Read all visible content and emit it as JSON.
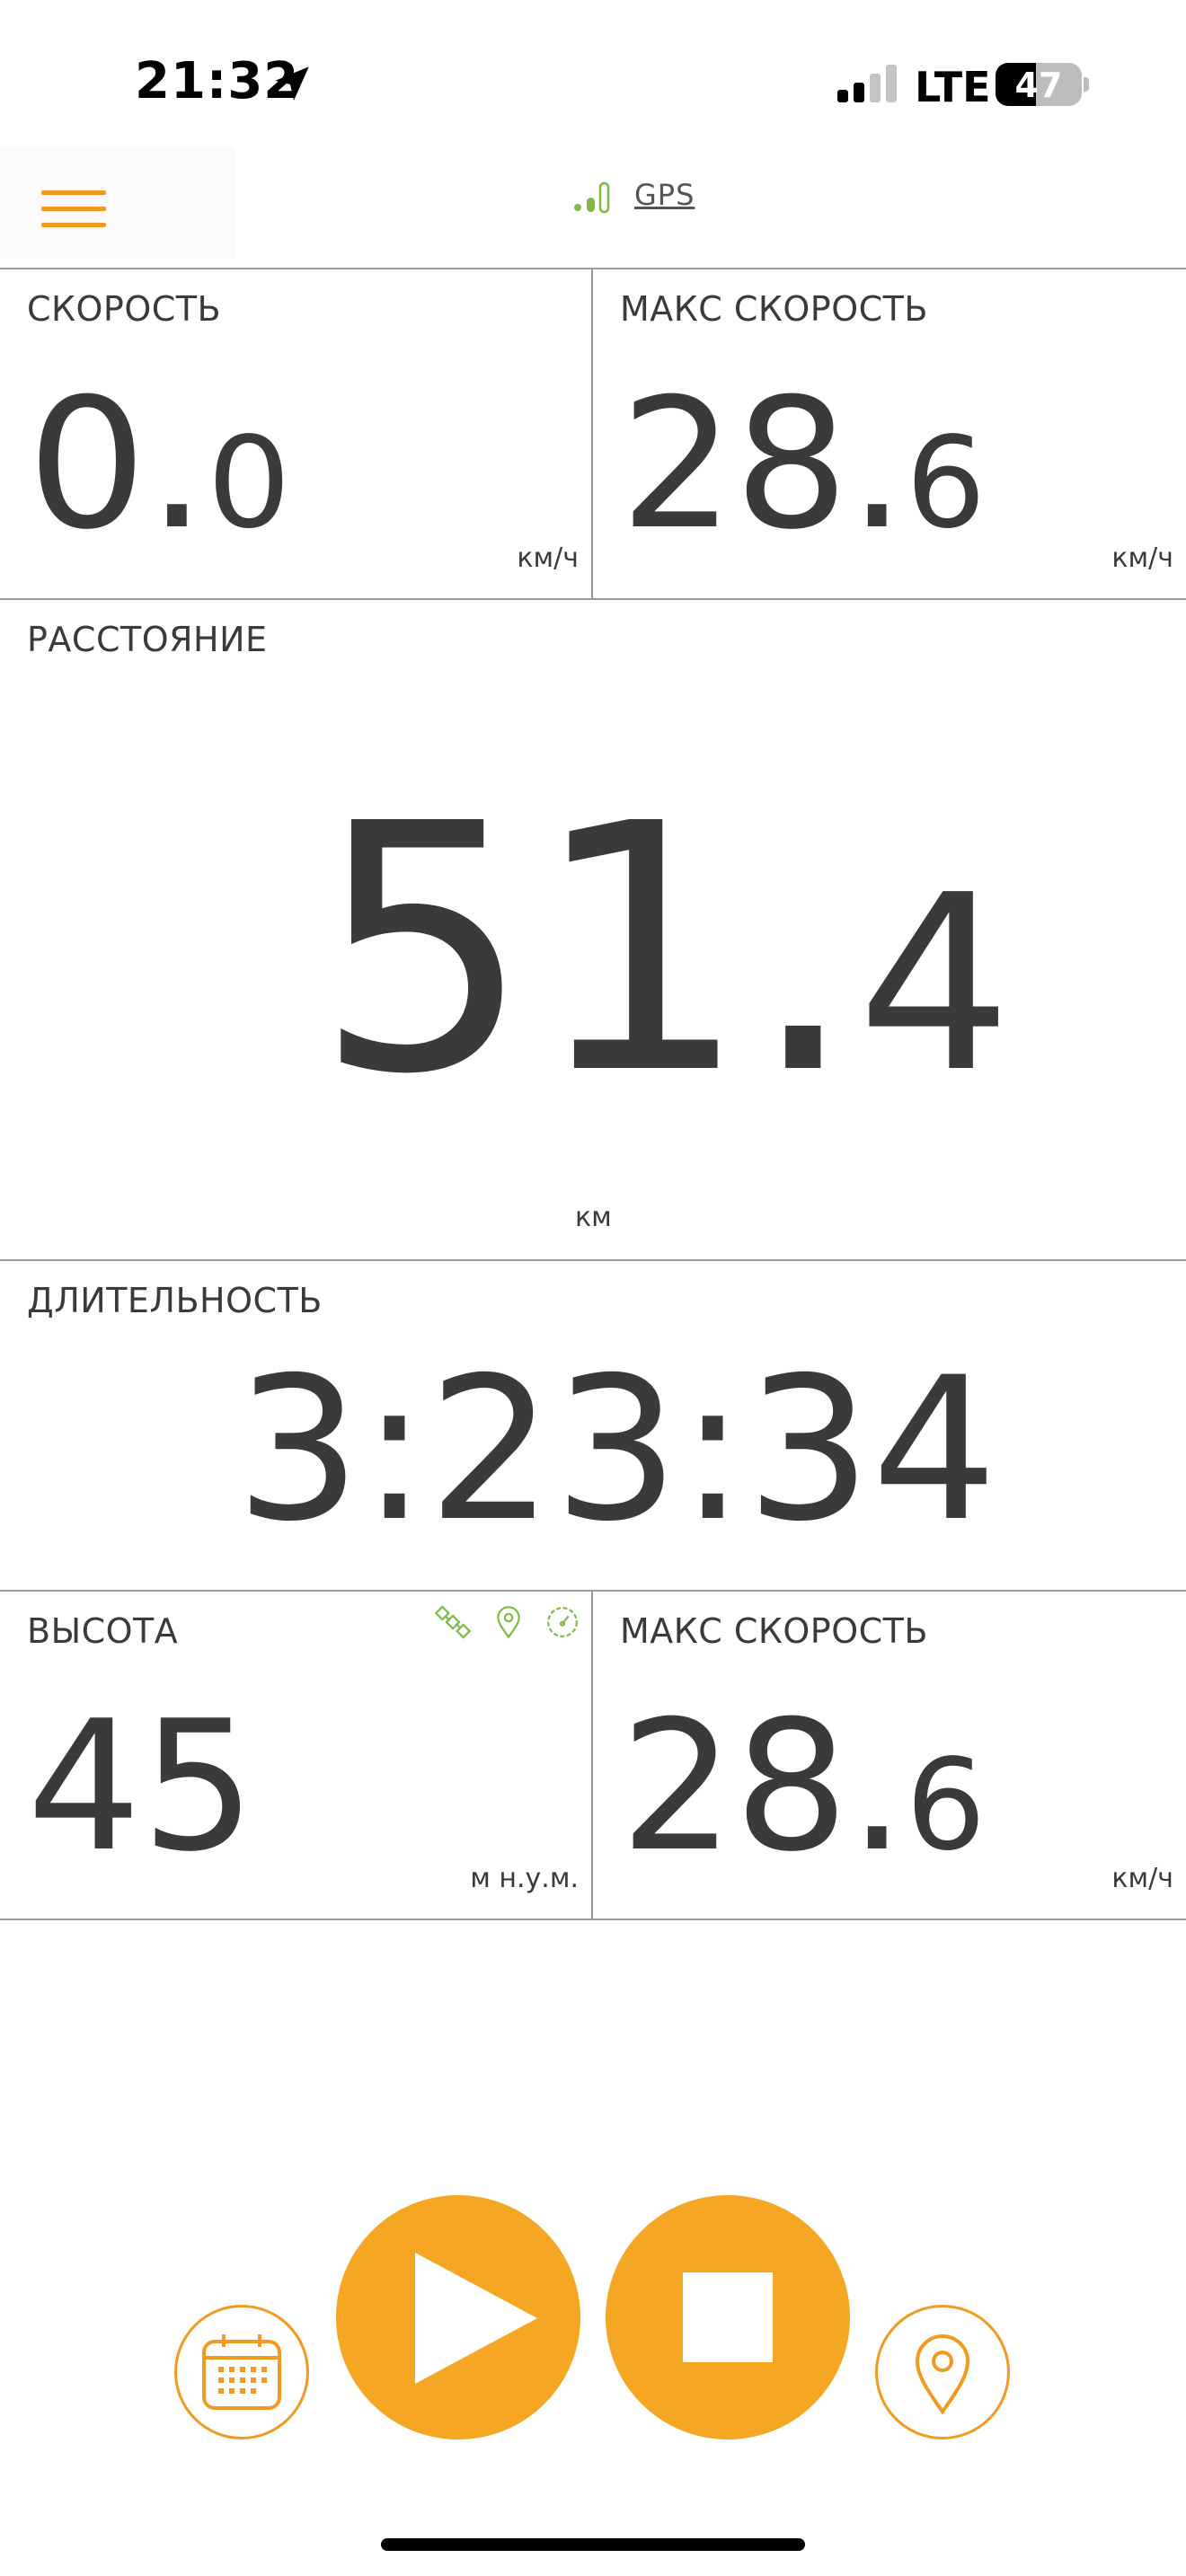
{
  "status_bar": {
    "time": "21:32",
    "network": "LTE",
    "battery": "47",
    "battery_level_percent": 47,
    "signal_bars_active": 2,
    "signal_bars_total": 4
  },
  "header": {
    "gps_label": "GPS",
    "menu_icon": "hamburger-icon",
    "gps_icon": "signal-strength-icon"
  },
  "colors": {
    "accent": "#f5a623",
    "gps_green": "#7dbb42",
    "text": "#3a3a3a",
    "divider": "#9a9a9a"
  },
  "tiles": {
    "speed": {
      "label": "СКОРОСТЬ",
      "int": "0",
      "dec": "0",
      "unit": "км/ч"
    },
    "max_speed_top": {
      "label": "МАКС СКОРОСТЬ",
      "int": "28.",
      "dec": "6",
      "unit": "км/ч"
    },
    "distance": {
      "label": "РАССТОЯНИЕ",
      "int": "51.",
      "dec": "4",
      "unit": "км"
    },
    "duration": {
      "label": "ДЛИТЕЛЬНОСТЬ",
      "value": "3:23:34"
    },
    "altitude": {
      "label": "ВЫСОТА",
      "value": "45",
      "unit": "м н.у.м.",
      "icons": [
        "satellite-icon",
        "map-pin-icon",
        "speedometer-icon"
      ]
    },
    "max_speed_bottom": {
      "label": "МАКС СКОРОСТЬ",
      "int": "28.",
      "dec": "6",
      "unit": "км/ч"
    }
  },
  "controls": {
    "calendar": "calendar-icon",
    "play": "play-icon",
    "stop": "stop-icon",
    "location": "location-pin-icon"
  }
}
